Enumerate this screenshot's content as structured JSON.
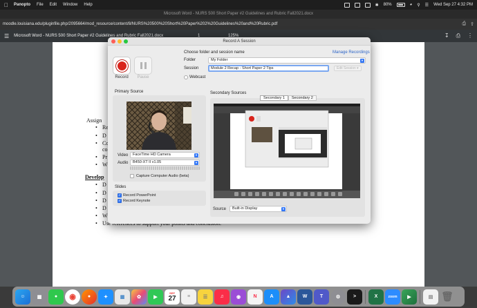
{
  "menubar": {
    "app_name": "Panopto",
    "menus": [
      "File",
      "Edit",
      "Window",
      "Help"
    ],
    "battery": "80%",
    "clock": "Wed Sep 27  4:32 PM"
  },
  "browser": {
    "window_title": "Microsoft Word - NURS 500 Short Paper #2 Guidelines and Rubric Fall2021.docx",
    "url": "moodle.louisiana.edu/pluginfile.php/2095664/mod_resource/content/8/NURS%20500%20Short%20Paper%202%20Guidelines%20and%20Rubric.pdf",
    "pdf_title": "Microsoft Word - NURS 500 Short Paper #2 Guidelines and Rubric Fall2021.docx",
    "page_num": "1",
    "zoom": "125%"
  },
  "document": {
    "heading_assign": "Assign",
    "bullets_1": [
      "Re",
      "D",
      "Co",
      "co",
      "Pr",
      "W"
    ],
    "heading_develop": "Develop",
    "bullets_2": [
      "D",
      "D",
      "D",
      "D",
      "W",
      "Use references to support your points and conclusion."
    ]
  },
  "panopto": {
    "window_title": "Record A Session",
    "record_label": "Record",
    "pause_label": "Pause",
    "choose_label": "Choose folder and session name",
    "manage_link": "Manage Recordings",
    "folder_label": "Folder",
    "folder_value": "My Folder",
    "session_label": "Session",
    "session_value": "Module 2 Recap - Short Paper 2 Tips",
    "edit_session": "Edit Session",
    "webcast_label": "Webcast",
    "primary_title": "Primary Source",
    "video_label": "Video",
    "video_value": "FaceTime HD Camera",
    "audio_label": "Audio",
    "audio_value": "B450-XT II v1.05",
    "capture_audio": "Capture Computer Audio (beta)",
    "slides_title": "Slides",
    "record_ppt": "Record PowerPoint",
    "record_keynote": "Record Keynote",
    "secondary_title": "Secondary Sources",
    "tab1": "Secondary 1",
    "tab2": "Secondary 2",
    "source_label": "Source",
    "source_value": "Built-in Display"
  },
  "dock": {
    "calendar_month": "SEP",
    "calendar_day": "27",
    "zoom_label": "zoom"
  },
  "colors": {
    "record_red": "#d9241c",
    "accent_blue": "#3478f6"
  }
}
